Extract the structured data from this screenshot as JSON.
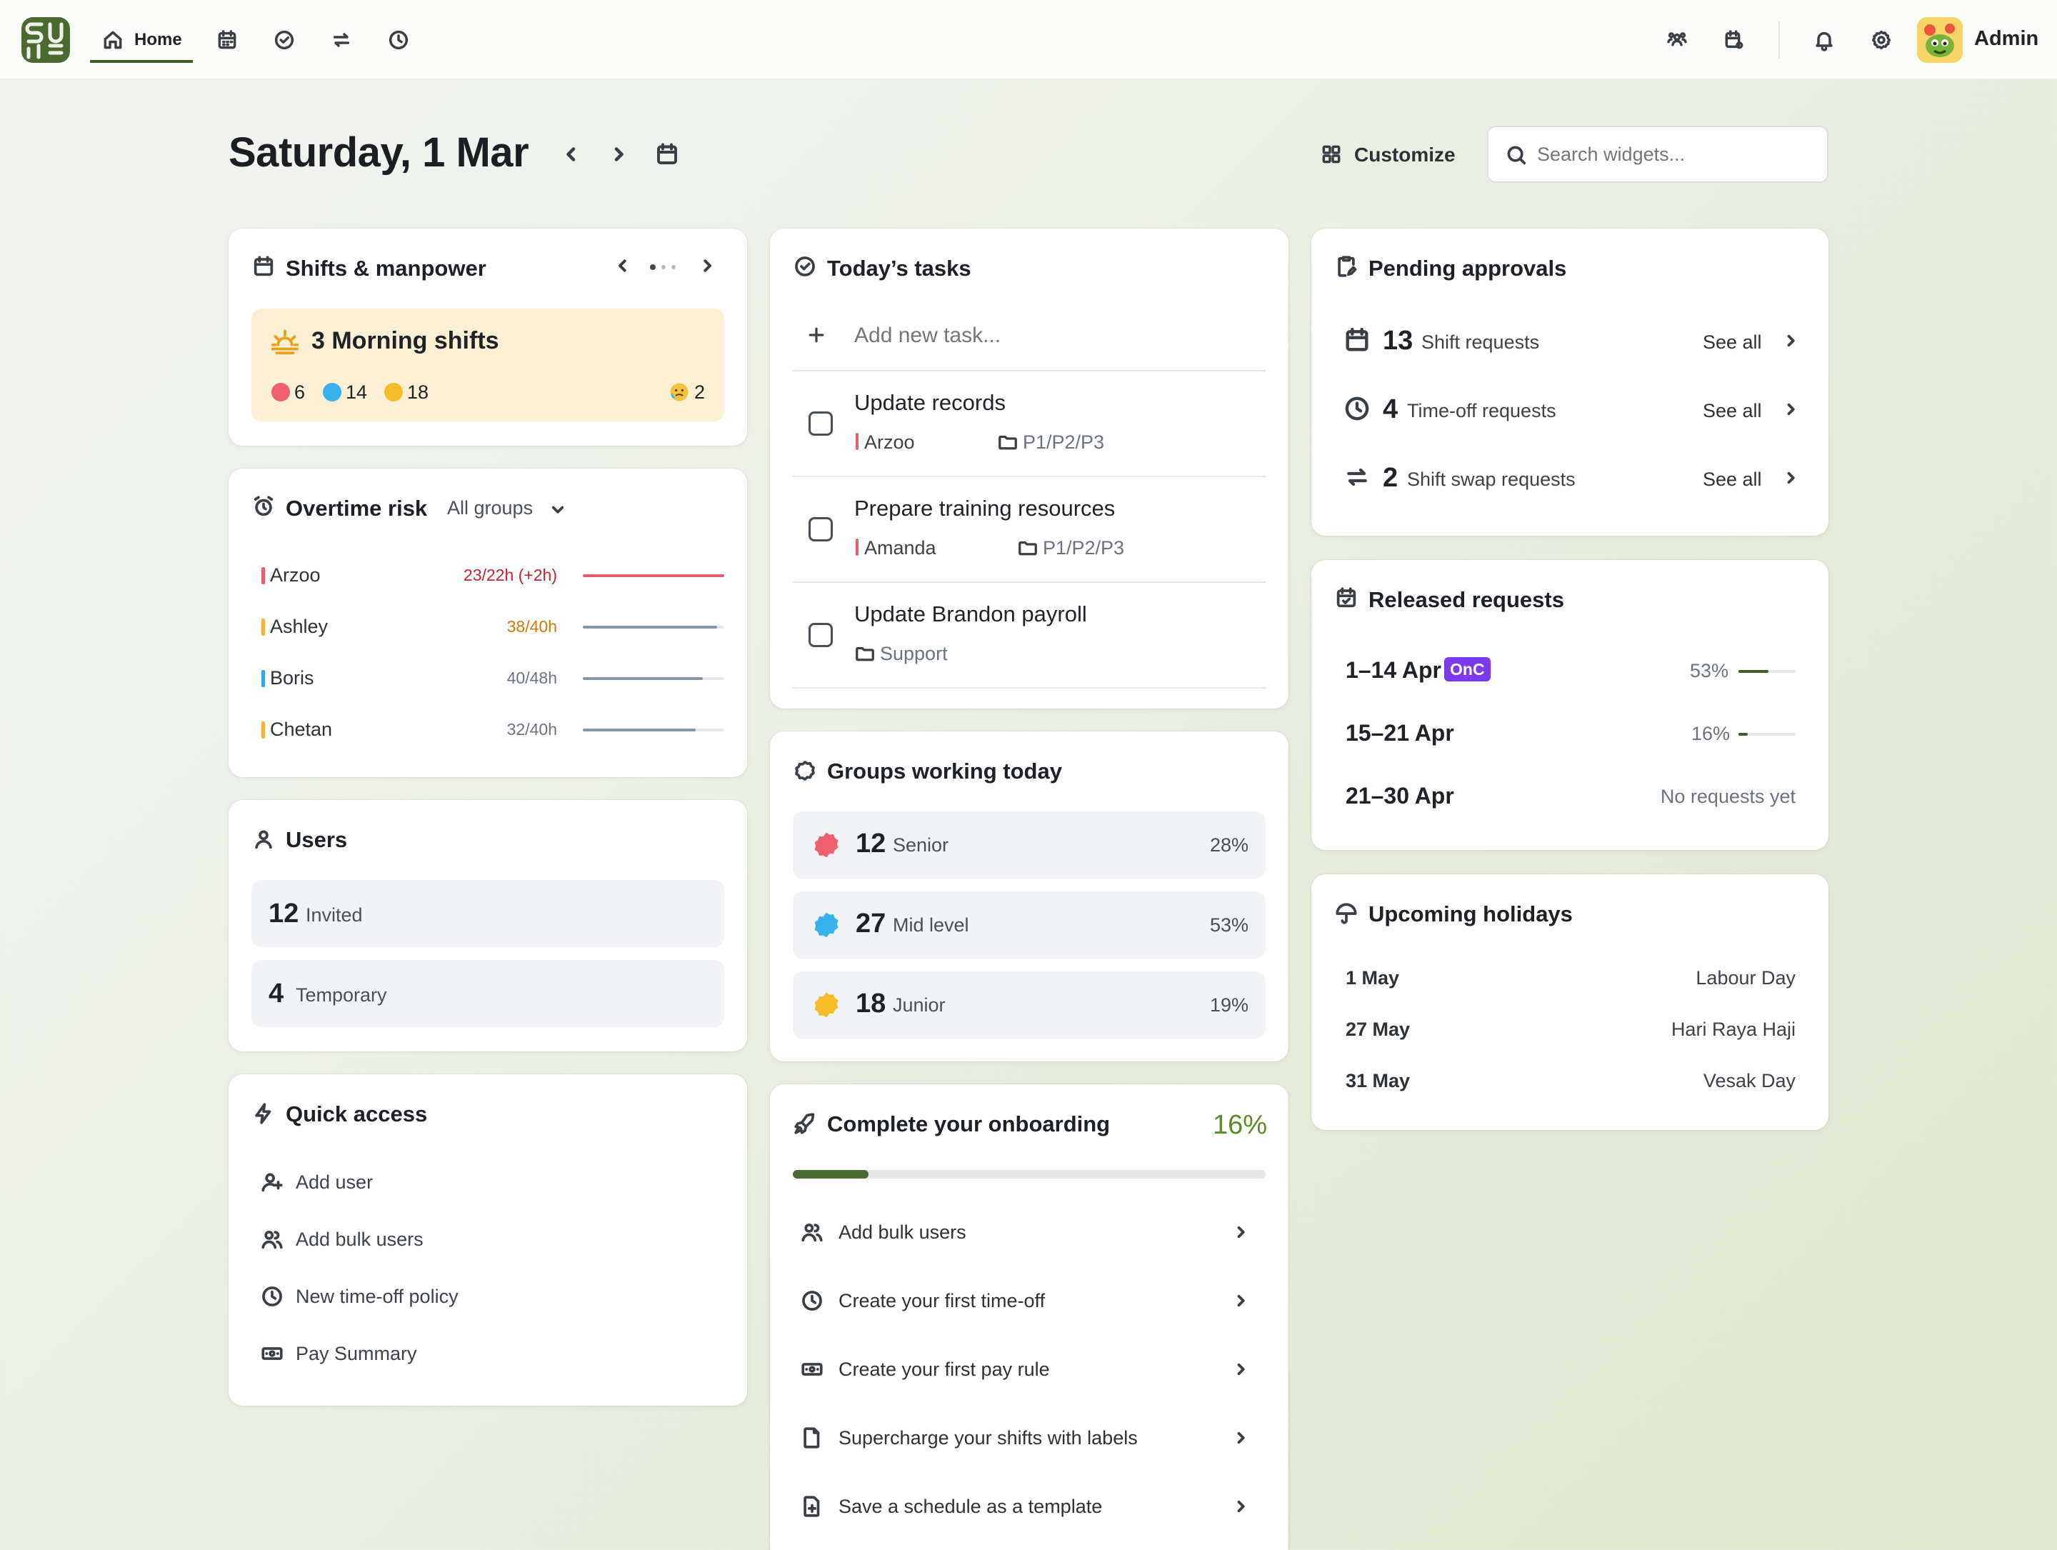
{
  "nav": {
    "home_label": "Home",
    "user_name": "Admin"
  },
  "header": {
    "date": "Saturday, 1 Mar",
    "customize": "Customize",
    "search_placeholder": "Search widgets..."
  },
  "shifts": {
    "title": "Shifts & manpower",
    "banner": "3 Morning shifts",
    "counts": [
      "6",
      "14",
      "18"
    ],
    "extra": "2"
  },
  "overtime": {
    "title": "Overtime risk",
    "filter": "All groups",
    "rows": [
      {
        "name": "Arzoo",
        "hours": "23/22h (+2h)",
        "level": 1.0,
        "color": "#e5606e",
        "text_color": "#c0262f"
      },
      {
        "name": "Ashley",
        "hours": "38/40h",
        "level": 0.95,
        "color": "#f0b43c",
        "text_color": "#d27a06"
      },
      {
        "name": "Boris",
        "hours": "40/48h",
        "level": 0.85,
        "color": "#3aa6e8",
        "text_color": "#6b7280"
      },
      {
        "name": "Chetan",
        "hours": "32/40h",
        "level": 0.8,
        "color": "#f0b43c",
        "text_color": "#6b7280"
      }
    ]
  },
  "users": {
    "title": "Users",
    "items": [
      {
        "count": "12",
        "label": "Invited"
      },
      {
        "count": "4",
        "label": "Temporary"
      }
    ]
  },
  "quick": {
    "title": "Quick access",
    "items": [
      "Add user",
      "Add bulk users",
      "New time-off policy",
      "Pay Summary"
    ]
  },
  "tasks": {
    "title": "Today’s tasks",
    "add_placeholder": "Add new task...",
    "items": [
      {
        "title": "Update records",
        "assignee": "Arzoo",
        "folder": "P1/P2/P3"
      },
      {
        "title": "Prepare training resources",
        "assignee": "Amanda",
        "folder": "P1/P2/P3"
      },
      {
        "title": "Update Brandon payroll",
        "assignee": "",
        "folder": "Support"
      }
    ]
  },
  "groups": {
    "title": "Groups working today",
    "items": [
      {
        "count": "12",
        "label": "Senior",
        "pct": "28%",
        "color": "#f0616f"
      },
      {
        "count": "27",
        "label": "Mid level",
        "pct": "53%",
        "color": "#38b2ee"
      },
      {
        "count": "18",
        "label": "Junior",
        "pct": "19%",
        "color": "#f5bd2a"
      }
    ]
  },
  "onboarding": {
    "title": "Complete your onboarding",
    "percent": "16%",
    "progress": 0.16,
    "items": [
      "Add bulk users",
      "Create your first time-off",
      "Create your first pay rule",
      "Supercharge your shifts with labels",
      "Save a schedule as a template"
    ]
  },
  "approvals": {
    "title": "Pending approvals",
    "see_all": "See all",
    "items": [
      {
        "count": "13",
        "label": "Shift requests"
      },
      {
        "count": "4",
        "label": "Time-off requests"
      },
      {
        "count": "2",
        "label": "Shift swap requests"
      }
    ]
  },
  "released": {
    "title": "Released requests",
    "badge": "OnC",
    "items": [
      {
        "range": "1–14 Apr",
        "pct": "53%",
        "level": 0.53
      },
      {
        "range": "15–21 Apr",
        "pct": "16%",
        "level": 0.16
      },
      {
        "range": "21–30 Apr",
        "note": "No requests yet"
      }
    ]
  },
  "holidays": {
    "title": "Upcoming holidays",
    "items": [
      {
        "date": "1 May",
        "name": "Labour Day"
      },
      {
        "date": "27 May",
        "name": "Hari Raya Haji"
      },
      {
        "date": "31 May",
        "name": "Vesak Day"
      }
    ]
  }
}
